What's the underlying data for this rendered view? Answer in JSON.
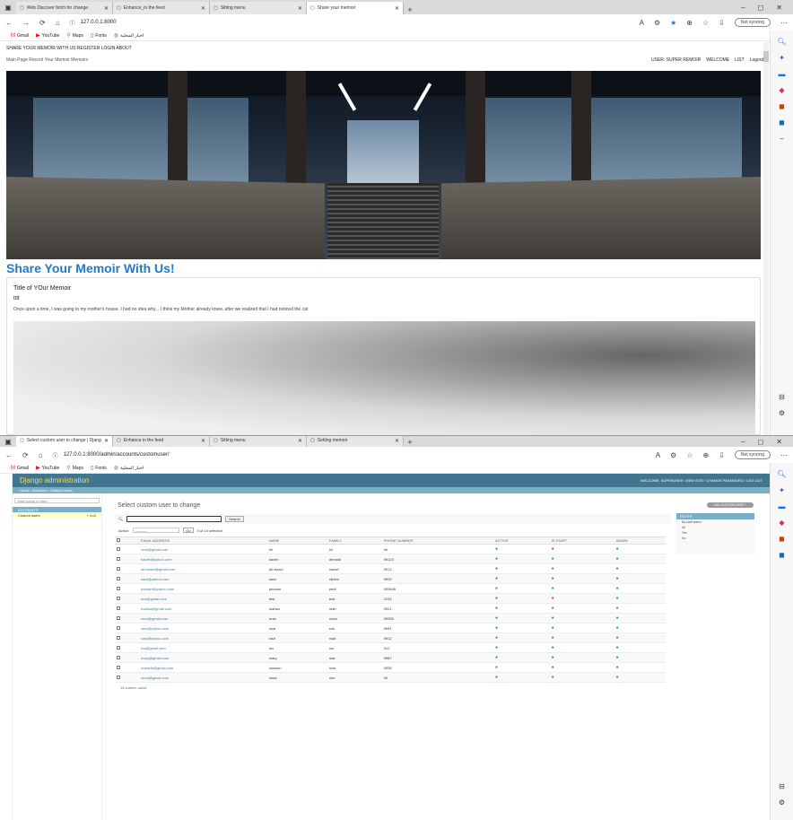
{
  "top_window": {
    "tabs": [
      {
        "title": "Web Discover fetch for change",
        "active": false
      },
      {
        "title": "Enhance_in the feed",
        "active": false
      },
      {
        "title": "Sitting menu",
        "active": false
      },
      {
        "title": "Share your memoir",
        "active": true
      }
    ],
    "url": "127.0.0.1:8000",
    "profile_label": "Not syncing",
    "bookmarks": [
      {
        "icon": "gmail-icon",
        "label": "Gmail"
      },
      {
        "icon": "youtube-icon",
        "label": "YouTube"
      },
      {
        "icon": "maps-icon",
        "label": "Maps"
      },
      {
        "icon": "folder-icon",
        "label": "Fonts"
      },
      {
        "icon": "web-icon",
        "label": "اخبار المحلية"
      }
    ],
    "site_header": "SHARE YOUR MEMOIR WITH US REGISTER LOGIN ABOUT",
    "site_nav_left": "Main Page   Record Your Memoir   Memoirs",
    "site_nav_right": [
      "USER: SUPER REMOIR",
      "WELCOME",
      "LIST",
      "Logout"
    ],
    "page_title": "Share Your Memoir With Us!",
    "memoir": {
      "title_label": "Title of YOur Memoir",
      "subtitle": "tttt",
      "body": "Once upon a time, I was going to my mother's house. I had no idea why... I think my Mother already knew, after we realized that I had noticed the cat"
    }
  },
  "bottom_window": {
    "tabs": [
      {
        "title": "Select custom user to change | Django",
        "active": true
      },
      {
        "title": "Enhance in the feed",
        "active": false
      },
      {
        "title": "Sitting menu",
        "active": false
      },
      {
        "title": "Setting memoir",
        "active": false
      }
    ],
    "url": "127.0.0.1:8000/admin/accounts/customuser/",
    "profile_label": "Not syncing",
    "bookmarks": [
      {
        "icon": "gmail-icon",
        "label": "Gmail"
      },
      {
        "icon": "youtube-icon",
        "label": "YouTube"
      },
      {
        "icon": "maps-icon",
        "label": "Maps"
      },
      {
        "icon": "folder-icon",
        "label": "Fonts"
      },
      {
        "icon": "web-icon",
        "label": "اخبار المحلية"
      }
    ],
    "admin": {
      "brand": "Django administration",
      "user_tools": "WELCOME, SUPERUSER. VIEW SITE / CHANGE PASSWORD / LOG OUT",
      "breadcrumbs": "Home › Accounts › Custom users",
      "sidebar_filter_placeholder": "Start typing to filter...",
      "app_label": "ACCOUNTS",
      "model_label": "Custom users",
      "model_add": "+ Add",
      "heading": "Select custom user to change",
      "search_button": "Search",
      "action_label": "Action:",
      "action_value": "---------",
      "go_button": "Go",
      "selected_text": "0 of 14 selected",
      "add_button": "ADD CUSTOM USER +",
      "filter_title": "FILTER",
      "filter_items": [
        "By staff status",
        "All",
        "Yes",
        "No"
      ],
      "columns": [
        "EMAIL ADDRESS",
        "NAME",
        "FAMILY",
        "PHONE NUMBER",
        "ACTIVE",
        "IS STAFF",
        "ADMIN"
      ],
      "rows": [
        {
          "email": "hmd@gmail.com",
          "name": "hh",
          "family": "hh",
          "phone": "hh",
          "active": true,
          "staff": false,
          "admin": true
        },
        {
          "email": "kaveh@yahoo.com",
          "name": "kaveh",
          "family": "ahmadi",
          "phone": "09124",
          "active": true,
          "staff": true,
          "admin": true
        },
        {
          "email": "ali.razavi@gmail.com",
          "name": "ali razavi",
          "family": "razavi",
          "phone": "0912",
          "active": true,
          "staff": true,
          "admin": true
        },
        {
          "email": "sara@yahoo.com",
          "name": "sara",
          "family": "rahimi",
          "phone": "0939",
          "active": true,
          "staff": true,
          "admin": true
        },
        {
          "email": "pedram@yahoo.com",
          "name": "pedram",
          "family": "pedi",
          "phone": "093545",
          "active": true,
          "staff": true,
          "admin": true
        },
        {
          "email": "test@gmail.com",
          "name": "test",
          "family": "test",
          "phone": "1234",
          "active": true,
          "staff": false,
          "admin": true
        },
        {
          "email": "mahsa@gmail.com",
          "name": "mahsa",
          "family": "mah",
          "phone": "0921",
          "active": true,
          "staff": true,
          "admin": true
        },
        {
          "email": "reza@gmail.com",
          "name": "reza",
          "family": "rezai",
          "phone": "09355",
          "active": true,
          "staff": true,
          "admin": true
        },
        {
          "email": "sina@yahoo.com",
          "name": "sina",
          "family": "sini",
          "phone": "0991",
          "active": true,
          "staff": true,
          "admin": true
        },
        {
          "email": "nazi@yahoo.com",
          "name": "nazi",
          "family": "nazi",
          "phone": "0912",
          "active": true,
          "staff": true,
          "admin": true
        },
        {
          "email": "ms@gmail.com",
          "name": "ms",
          "family": "ms",
          "phone": "012",
          "active": true,
          "staff": true,
          "admin": true
        },
        {
          "email": "mary@gmail.com",
          "name": "mary",
          "family": "mar",
          "phone": "0987",
          "active": true,
          "staff": true,
          "admin": true
        },
        {
          "email": "hossein@gmail.com",
          "name": "hossein",
          "family": "hosi",
          "phone": "0935",
          "active": true,
          "staff": true,
          "admin": true
        },
        {
          "email": "nima@gmail.com",
          "name": "nima",
          "family": "nim",
          "phone": "09",
          "active": true,
          "staff": true,
          "admin": true
        }
      ],
      "footer": "14 custom users"
    }
  }
}
